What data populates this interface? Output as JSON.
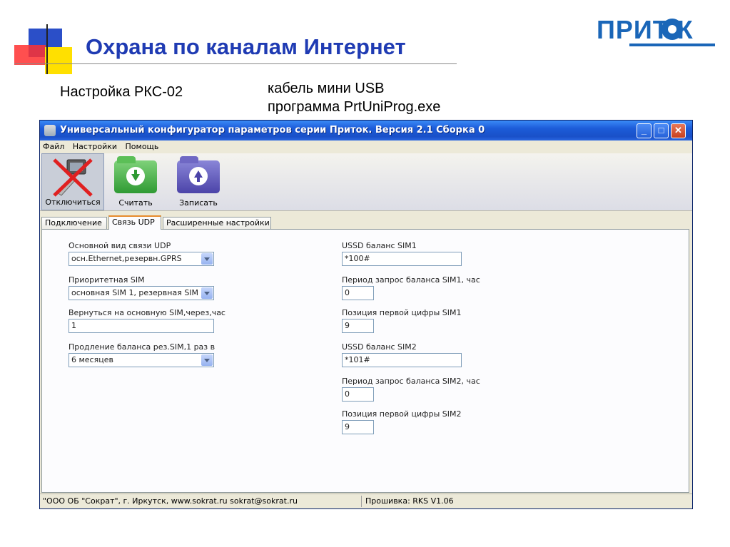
{
  "slide": {
    "title": "Охрана по каналам Интернет",
    "subtitle_left": "Настройка РКС-02",
    "subtitle_right_line1": "кабель мини USB",
    "subtitle_right_line2": "программа  PrtUniProg.exe",
    "logo_text": "ПРИТ  К",
    "accent_color": "#1f3bb3"
  },
  "window": {
    "title": "Универсальный конфигуратор параметров серии Приток. Версия 2.1 Сборка 0",
    "menu": [
      "Файл",
      "Настройки",
      "Помощь"
    ],
    "toolbar": {
      "disconnect_label": "Отключиться",
      "read_label": "Считать",
      "write_label": "Записать"
    },
    "tabs": [
      "Подключение",
      "Связь UDP",
      "Расширенные настройки"
    ],
    "active_tab": "Связь UDP",
    "left_fields": {
      "udp_mode_label": "Основной вид связи UDP",
      "udp_mode_value": "осн.Ethernet,резервн.GPRS",
      "sim_priority_label": "Приоритетная SIM",
      "sim_priority_value": "основная SIM 1, резервная SIM",
      "return_label": "Вернуться на основную SIM,через,час",
      "return_value": "1",
      "balance_ext_label": "Продление баланса рез.SIM,1 раз в",
      "balance_ext_value": "6 месяцев"
    },
    "right_fields": {
      "ussd1_label": "USSD баланс SIM1",
      "ussd1_value": "*100#",
      "period1_label": "Период запрос баланса SIM1, час",
      "period1_value": "0",
      "pos1_label": "Позиция первой цифры SIM1",
      "pos1_value": "9",
      "ussd2_label": "USSD баланс SIM2",
      "ussd2_value": "*101#",
      "period2_label": "Период запрос баланса SIM2, час",
      "period2_value": "0",
      "pos2_label": "Позиция первой цифры SIM2",
      "pos2_value": "9"
    },
    "status": {
      "company": "\"ООО ОБ \"Сократ\", г. Иркутск,     www.sokrat.ru   sokrat@sokrat.ru",
      "firmware": "Прошивка: RKS V1.06"
    }
  }
}
